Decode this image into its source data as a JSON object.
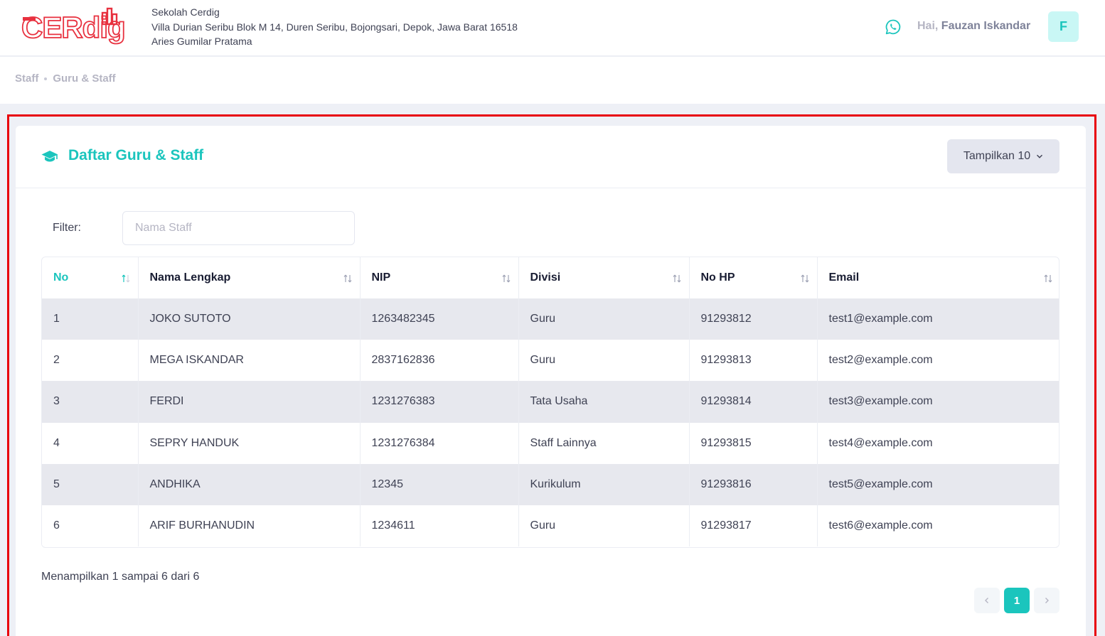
{
  "header": {
    "school_name": "Sekolah Cerdig",
    "school_address": "Villa Durian Seribu Blok M 14, Duren Seribu, Bojongsari, Depok, Jawa Barat 16518",
    "principal": "Aries Gumilar Pratama",
    "greeting": "Hai, ",
    "user_name": "Fauzan Iskandar",
    "avatar_initial": "F",
    "logo_text": "CERdig"
  },
  "breadcrumb": {
    "items": [
      "Staff",
      "Guru & Staff"
    ]
  },
  "card": {
    "title": "Daftar Guru & Staff",
    "show_button": "Tampilkan 10",
    "filter_label": "Filter:",
    "filter_placeholder": "Nama Staff"
  },
  "table": {
    "columns": [
      "No",
      "Nama Lengkap",
      "NIP",
      "Divisi",
      "No HP",
      "Email"
    ],
    "rows": [
      [
        "1",
        "JOKO SUTOTO",
        "1263482345",
        "Guru",
        "91293812",
        "test1@example.com"
      ],
      [
        "2",
        "MEGA ISKANDAR",
        "2837162836",
        "Guru",
        "91293813",
        "test2@example.com"
      ],
      [
        "3",
        "FERDI",
        "1231276383",
        "Tata Usaha",
        "91293814",
        "test3@example.com"
      ],
      [
        "4",
        "SEPRY HANDUK",
        "1231276384",
        "Staff Lainnya",
        "91293815",
        "test4@example.com"
      ],
      [
        "5",
        "ANDHIKA",
        "12345",
        "Kurikulum",
        "91293816",
        "test5@example.com"
      ],
      [
        "6",
        "ARIF BURHANUDIN",
        "1234611",
        "Guru",
        "91293817",
        "test6@example.com"
      ]
    ]
  },
  "footer": {
    "info": "Menampilkan 1 sampai 6 dari 6",
    "current_page": "1"
  },
  "colors": {
    "accent": "#1bc5bd",
    "logo_red": "#e8313f",
    "highlight": "#e8000b"
  },
  "icons": {
    "whatsapp": "whatsapp-icon",
    "title": "graduation-cap-icon",
    "sort": "sort-icon",
    "prev": "chevron-left-icon",
    "next": "chevron-right-icon"
  }
}
